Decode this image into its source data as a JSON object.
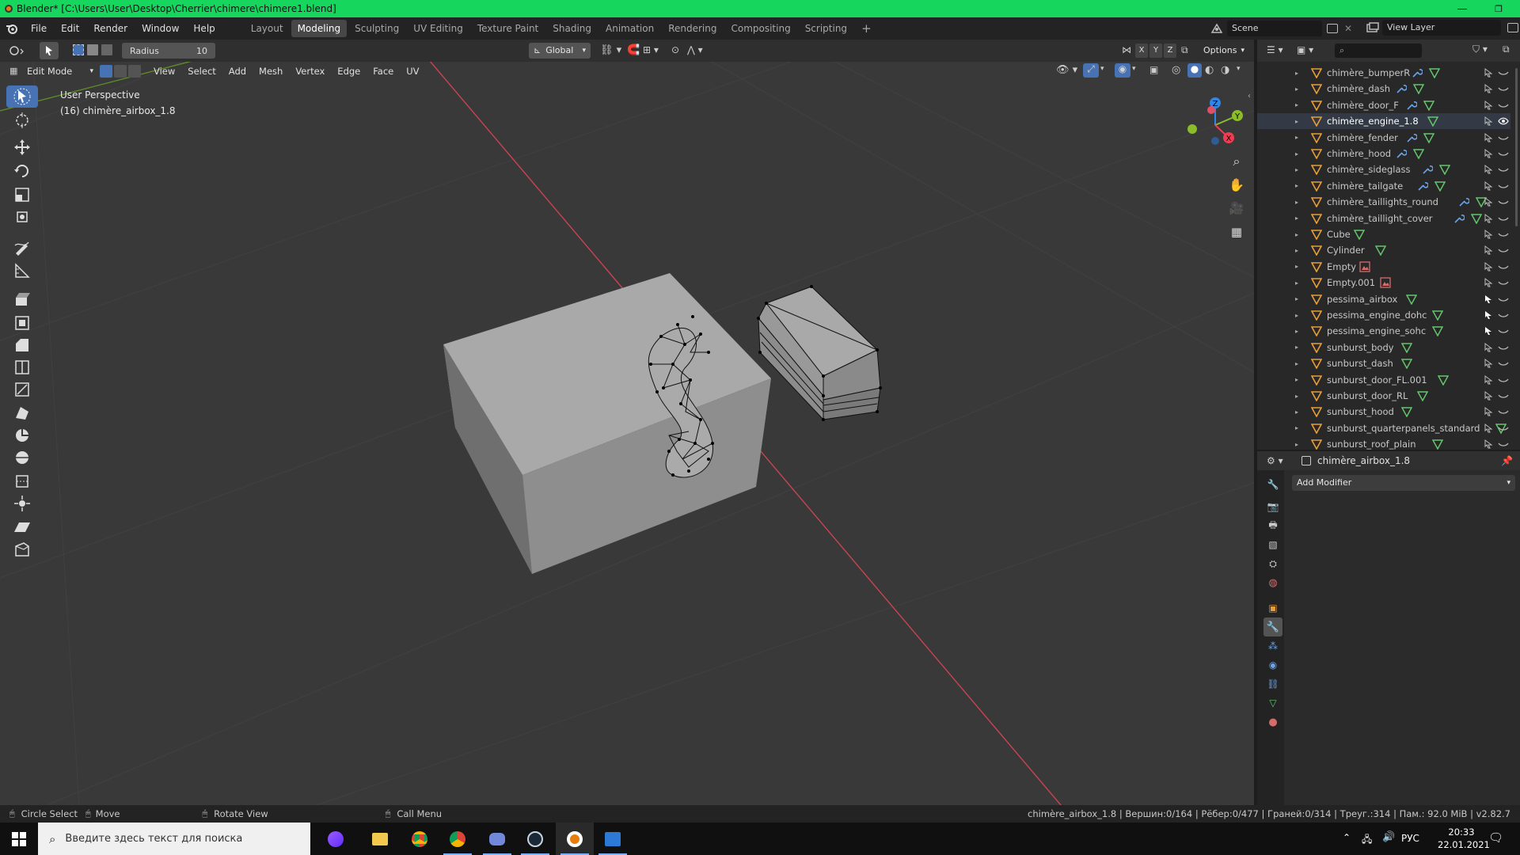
{
  "window": {
    "title": "Blender* [C:\\Users\\User\\Desktop\\Cherrier\\chimere\\chimere1.blend]",
    "controls": {
      "minimize": "—",
      "maximize": "❐",
      "close": "✕"
    }
  },
  "topbar": {
    "menus": [
      "File",
      "Edit",
      "Render",
      "Window",
      "Help"
    ],
    "workspaces": [
      "Layout",
      "Modeling",
      "Sculpting",
      "UV Editing",
      "Texture Paint",
      "Shading",
      "Animation",
      "Rendering",
      "Compositing",
      "Scripting"
    ],
    "active_workspace": "Modeling",
    "add_workspace": "+",
    "scene_name": "Scene",
    "view_layer_name": "View Layer"
  },
  "tool_header": {
    "radius_label": "Radius",
    "radius_value": "10",
    "orientation": "Global",
    "axes": [
      "X",
      "Y",
      "Z"
    ],
    "options_label": "Options"
  },
  "viewport_header": {
    "mode": "Edit Mode",
    "menus": [
      "View",
      "Select",
      "Add",
      "Mesh",
      "Vertex",
      "Edge",
      "Face",
      "UV"
    ]
  },
  "viewport": {
    "view_name": "User Perspective",
    "object_label": "(16) chimère_airbox_1.8",
    "gizmo": {
      "x": "X",
      "y": "Y",
      "z": "Z"
    },
    "colors": {
      "x_axis": "#ee3d52",
      "y_axis": "#8bbd2b",
      "z_axis": "#2e86e8",
      "background": "#393939"
    }
  },
  "outliner": {
    "search_placeholder": "",
    "items": [
      {
        "name": "chimère_bumperR",
        "icons": [
          "wrench",
          "mesh"
        ],
        "selectable": true
      },
      {
        "name": "chimère_dash",
        "icons": [
          "wrench",
          "mesh"
        ],
        "selectable": true
      },
      {
        "name": "chimère_door_F",
        "icons": [
          "wrench",
          "mesh"
        ],
        "selectable": true
      },
      {
        "name": "chimère_engine_1.8",
        "icons": [
          "mesh"
        ],
        "selectable": true,
        "highlighted": true,
        "visible": true
      },
      {
        "name": "chimère_fender",
        "icons": [
          "wrench",
          "mesh"
        ],
        "selectable": true
      },
      {
        "name": "chimère_hood",
        "icons": [
          "wrench",
          "mesh"
        ],
        "selectable": true
      },
      {
        "name": "chimère_sideglass",
        "icons": [
          "wrench",
          "mesh"
        ],
        "selectable": true
      },
      {
        "name": "chimère_tailgate",
        "icons": [
          "wrench",
          "mesh"
        ],
        "selectable": true
      },
      {
        "name": "chimère_taillights_round",
        "icons": [
          "wrench",
          "mesh"
        ],
        "selectable": true
      },
      {
        "name": "chimère_taillight_cover",
        "icons": [
          "wrench",
          "mesh"
        ],
        "selectable": true
      },
      {
        "name": "Cube",
        "icons": [
          "mesh"
        ],
        "selectable": true
      },
      {
        "name": "Cylinder",
        "icons": [
          "mesh"
        ],
        "selectable": true
      },
      {
        "name": "Empty",
        "icons": [
          "image"
        ],
        "selectable": true
      },
      {
        "name": "Empty.001",
        "icons": [
          "image"
        ],
        "selectable": true
      },
      {
        "name": "pessima_airbox",
        "icons": [
          "mesh"
        ],
        "selectable": false
      },
      {
        "name": "pessima_engine_dohc",
        "icons": [
          "mesh"
        ],
        "selectable": false
      },
      {
        "name": "pessima_engine_sohc",
        "icons": [
          "mesh"
        ],
        "selectable": false
      },
      {
        "name": "sunburst_body",
        "icons": [
          "mesh"
        ],
        "selectable": true
      },
      {
        "name": "sunburst_dash",
        "icons": [
          "mesh"
        ],
        "selectable": true
      },
      {
        "name": "sunburst_door_FL.001",
        "icons": [
          "mesh"
        ],
        "selectable": true
      },
      {
        "name": "sunburst_door_RL",
        "icons": [
          "mesh"
        ],
        "selectable": true
      },
      {
        "name": "sunburst_hood",
        "icons": [
          "mesh"
        ],
        "selectable": true
      },
      {
        "name": "sunburst_quarterpanels_standard",
        "icons": [
          "mesh"
        ],
        "selectable": true
      },
      {
        "name": "sunburst_roof_plain",
        "icons": [
          "mesh"
        ],
        "selectable": true
      }
    ]
  },
  "properties": {
    "object_name": "chimère_airbox_1.8",
    "add_modifier_label": "Add Modifier"
  },
  "statusbar": {
    "left": [
      {
        "label": "Circle Select"
      },
      {
        "label": "Move"
      },
      {
        "label": "Rotate View"
      },
      {
        "label": "Call Menu"
      }
    ],
    "stats": "chimère_airbox_1.8 | Вершин:0/164 | Рёбер:0/477 | Граней:0/314 | Треуг.:314 | Пам.: 92.0 MiB | v2.82.7"
  },
  "taskbar": {
    "search_placeholder": "Введите здесь текст для поиска",
    "language": "РУС",
    "time": "20:33",
    "date": "22.01.2021"
  }
}
